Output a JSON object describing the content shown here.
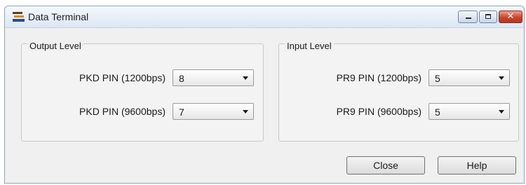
{
  "window": {
    "title": "Data Terminal",
    "close_glyph": "✕"
  },
  "output_level": {
    "legend": "Output Level",
    "rows": [
      {
        "label": "PKD PIN (1200bps)",
        "value": "8"
      },
      {
        "label": "PKD PIN (9600bps)",
        "value": "7"
      }
    ]
  },
  "input_level": {
    "legend": "Input Level",
    "rows": [
      {
        "label": "PR9 PIN (1200bps)",
        "value": "5"
      },
      {
        "label": "PR9 PIN (9600bps)",
        "value": "5"
      }
    ]
  },
  "buttons": {
    "close": "Close",
    "help": "Help"
  }
}
